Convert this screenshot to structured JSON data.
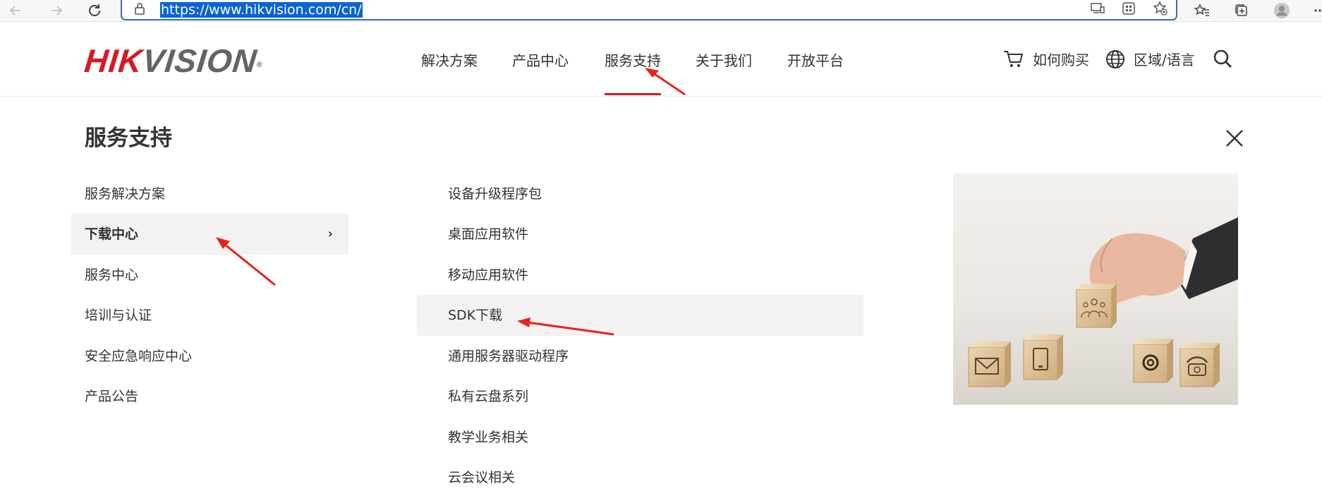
{
  "browser": {
    "url": "https://www.hikvision.com/cn/",
    "icons": [
      "back-arrow-icon",
      "forward-arrow-icon",
      "refresh-icon",
      "lock-icon",
      "device-cast-icon",
      "apps-icon",
      "favorite-add-icon",
      "favorites-icon",
      "collections-icon",
      "profile-icon",
      "more-icon"
    ]
  },
  "header": {
    "logo_red": "HIK",
    "logo_gray": "VISION",
    "logo_reg": "®",
    "nav": [
      "解决方案",
      "产品中心",
      "服务支持",
      "关于我们",
      "开放平台"
    ],
    "active_nav": "服务支持",
    "buy_label": "如何购买",
    "region_label": "区域/语言"
  },
  "menu": {
    "title": "服务支持",
    "left_items": [
      "服务解决方案",
      "下载中心",
      "服务中心",
      "培训与认证",
      "安全应急响应中心",
      "产品公告"
    ],
    "active_left": "下载中心",
    "right_items": [
      "设备升级程序包",
      "桌面应用软件",
      "移动应用软件",
      "SDK下载",
      "通用服务器驱动程序",
      "私有云盘系列",
      "教学业务相关",
      "云会议相关"
    ],
    "highlighted_right": "SDK下载",
    "chevron": "›",
    "promo_icons": [
      "mail-icon",
      "phone-icon",
      "at-icon",
      "telephone-icon",
      "people-icon"
    ]
  },
  "colors": {
    "brand_red": "#d71921",
    "logo_gray": "#636466",
    "annotation_red": "#e8231c",
    "highlight_bg": "#f2f2f2",
    "url_select": "#0a64d3"
  }
}
